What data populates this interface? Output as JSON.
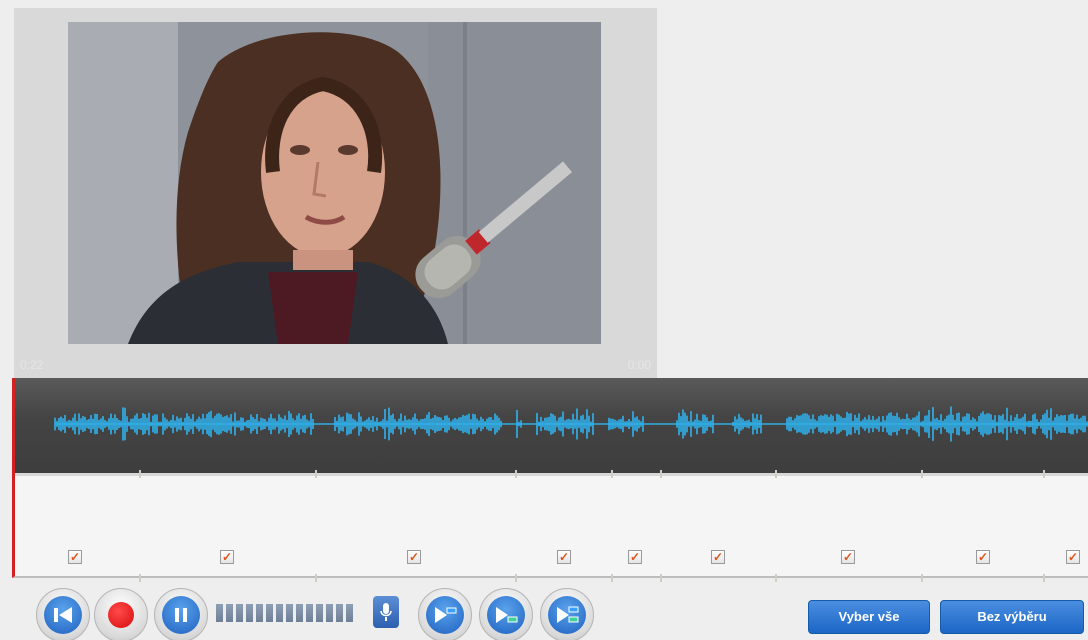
{
  "video": {
    "time_current": "0:22",
    "time_total": "0:00"
  },
  "segments": {
    "checkboxes_checked": [
      true,
      true,
      true,
      true,
      true,
      true,
      true,
      true,
      true
    ],
    "check_glyph": "✓"
  },
  "controls": {
    "rewind_icon": "skip-to-start-icon",
    "record_icon": "record-icon",
    "pause_icon": "pause-icon",
    "mic_icon": "microphone-icon",
    "play_segment_icons": [
      "play-segment-icon",
      "play-segment-end-icon",
      "play-all-segments-icon"
    ]
  },
  "actions": {
    "select_all_label": "Vyber vše",
    "deselect_label": "Bez výběru"
  },
  "colors": {
    "waveform": "#2fb3ee",
    "record_red": "#e01010",
    "button_blue": "#1c66c6",
    "marker_red": "#d32020",
    "checkmark": "#e2531d"
  }
}
